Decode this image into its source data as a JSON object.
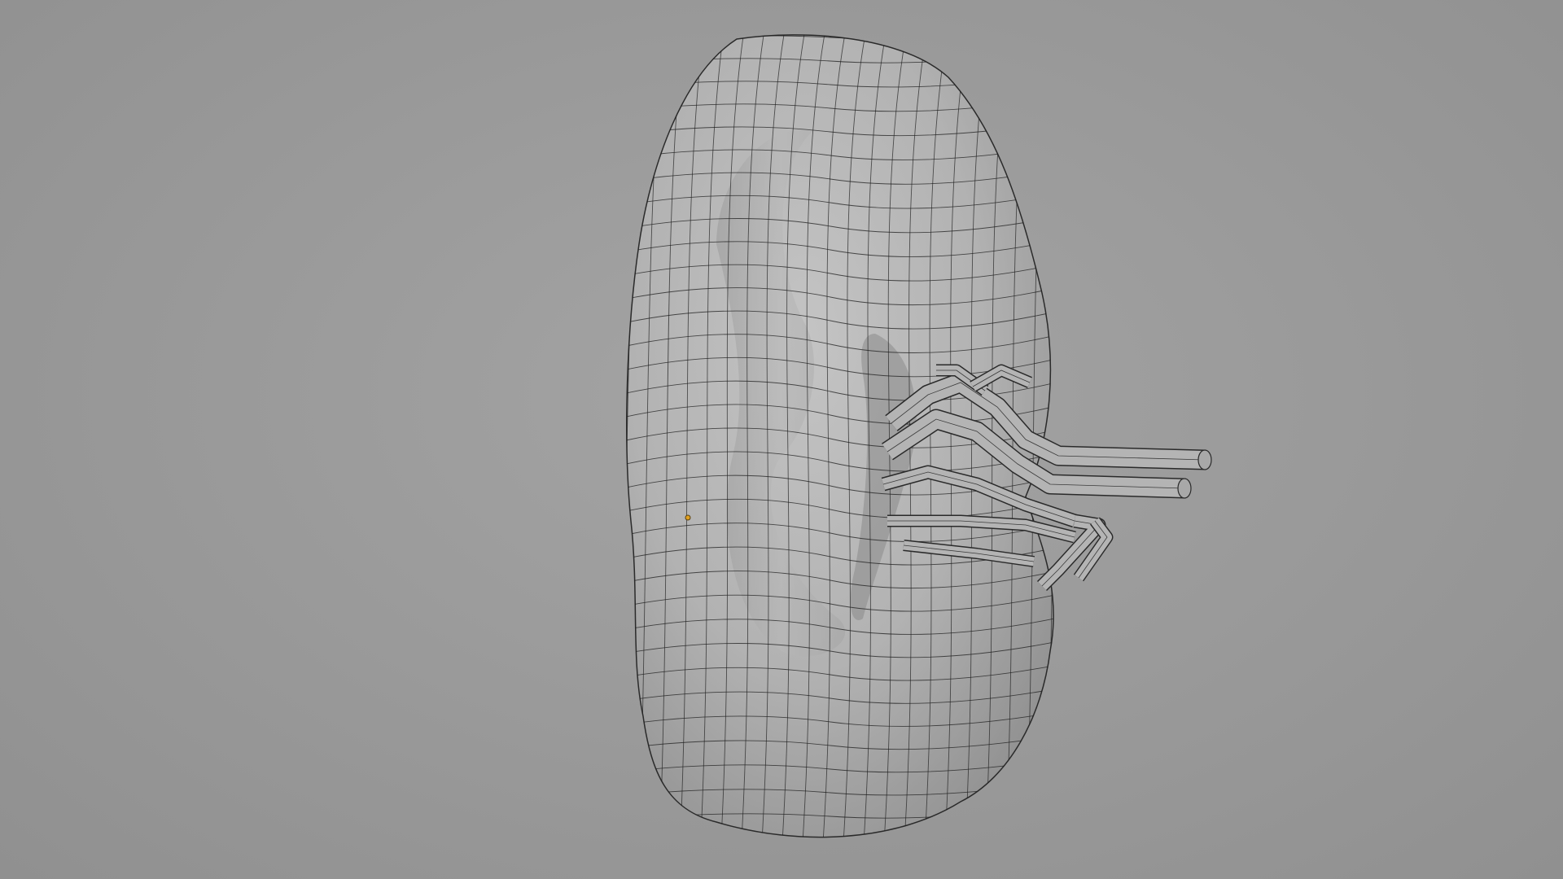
{
  "viewport": {
    "background_color": "#9a9a9a",
    "object": {
      "kind": "kidney-mesh",
      "display": "solid-wireframe",
      "surface_color": "#b4b4b4",
      "wire_color": "#1e1e1e",
      "origin_marker_color": "#e0a020"
    }
  }
}
